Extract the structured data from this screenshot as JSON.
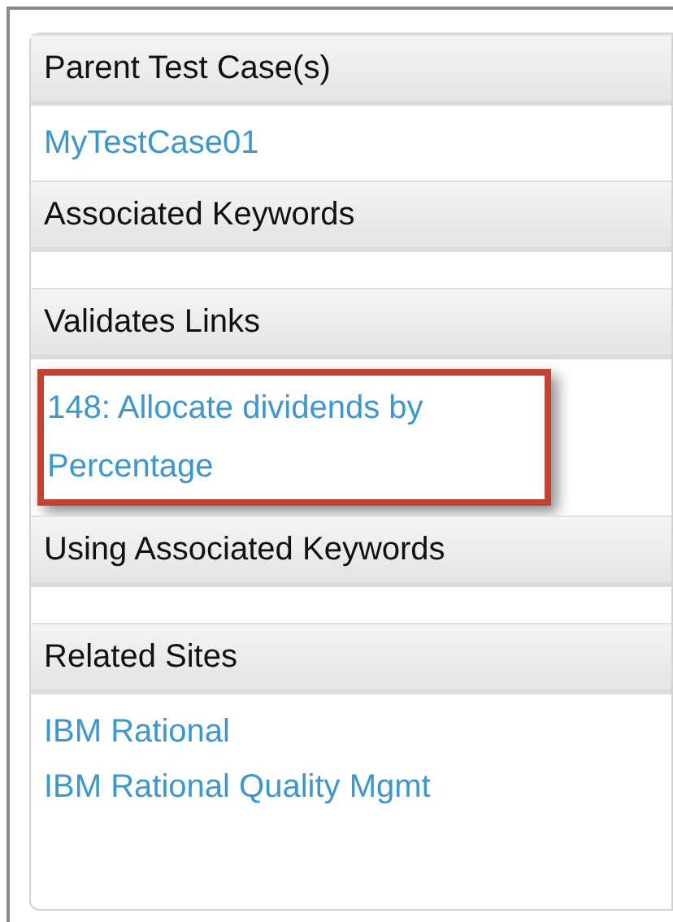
{
  "sections": [
    {
      "title": "Parent Test Case(s)",
      "links": [
        {
          "text": "MyTestCase01",
          "highlighted": false
        }
      ]
    },
    {
      "title": "Associated Keywords"
    },
    {
      "title": "Validates Links",
      "links": [
        {
          "text": "148: Allocate dividends by Percentage",
          "highlighted": true
        }
      ]
    },
    {
      "title": "Using Associated Keywords"
    },
    {
      "title": "Related Sites",
      "links": [
        {
          "text": "IBM Rational",
          "highlighted": false
        },
        {
          "text": "IBM Rational Quality Mgmt",
          "highlighted": false
        }
      ]
    }
  ]
}
